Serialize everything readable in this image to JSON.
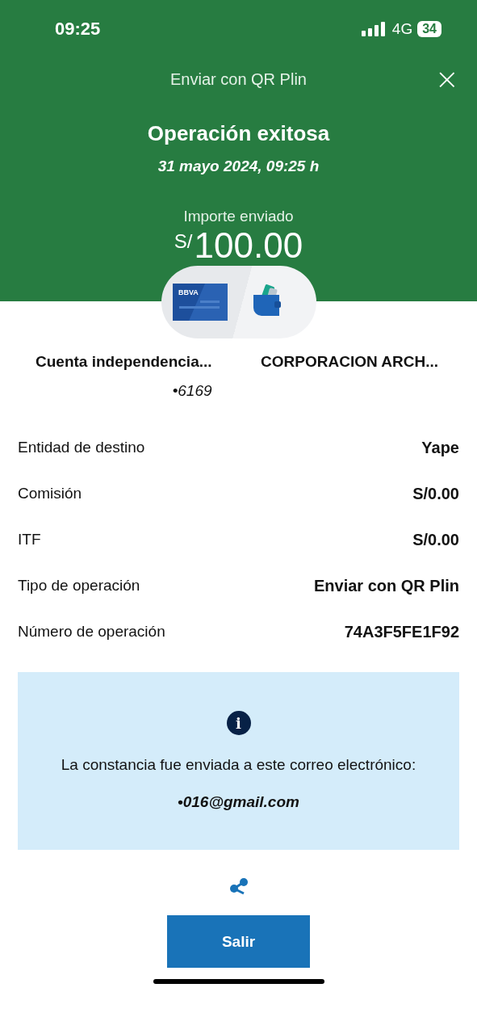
{
  "status_bar": {
    "time": "09:25",
    "network": "4G",
    "battery": "34"
  },
  "header": {
    "title": "Enviar con QR Plin",
    "close": "×"
  },
  "result": {
    "title": "Operación exitosa",
    "date": "31 mayo 2024, 09:25 h",
    "amount_label": "Importe enviado",
    "currency": "S/",
    "amount": "100.00"
  },
  "transfer": {
    "card_brand": "BBVA",
    "from_name": "Cuenta independencia...",
    "from_account": "•6169",
    "to_name": "CORPORACION ARCH..."
  },
  "details": [
    {
      "label": "Entidad de destino",
      "value": "Yape"
    },
    {
      "label": "Comisión",
      "value": "S/0.00"
    },
    {
      "label": "ITF",
      "value": "S/0.00"
    },
    {
      "label": "Tipo de operación",
      "value": "Enviar con QR Plin"
    },
    {
      "label": "Número de operación",
      "value": "74A3F5FE1F92"
    }
  ],
  "notice": {
    "icon": "i",
    "text": "La constancia fue enviada a este correo electrónico:",
    "email": "•016@gmail.com"
  },
  "exit_button": "Salir"
}
